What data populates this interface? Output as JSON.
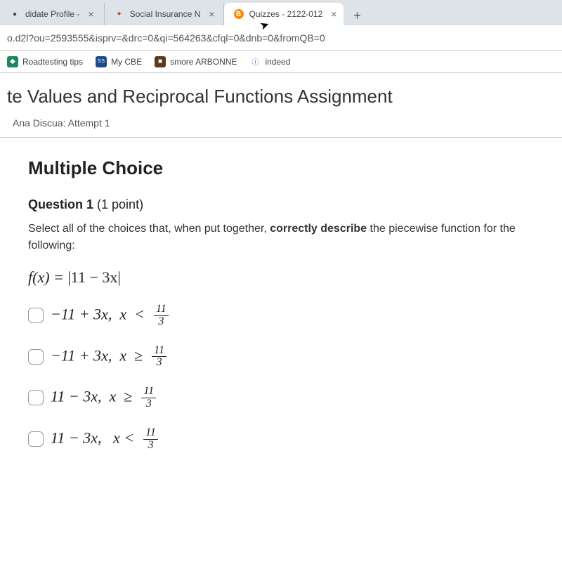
{
  "tabs": [
    {
      "label": "didate Profile -",
      "favicon_color": "#888"
    },
    {
      "label": "Social Insurance N",
      "favicon_color": "#d52b1e"
    },
    {
      "label": "Quizzes - 2122-012",
      "favicon_color": "#ff8a00",
      "active": true
    }
  ],
  "address_url": "o.d2l?ou=2593555&isprv=&drc=0&qi=564263&cfql=0&dnb=0&fromQB=0",
  "bookmarks": [
    {
      "label": "Roadtesting tips",
      "icon_bg": "#1a8a5a"
    },
    {
      "label": "My CBE",
      "icon_bg": "#1a4d8a"
    },
    {
      "label": "smore ARBONNE",
      "icon_bg": "#5a3a1a"
    },
    {
      "label": "indeed",
      "icon_bg": "transparent"
    }
  ],
  "page_title": "te Values and Reciprocal Functions Assignment",
  "attempt": "Ana Discua: Attempt 1",
  "section_heading": "Multiple Choice",
  "question_number": "Question 1",
  "question_points": "(1 point)",
  "question_prompt_a": "Select all of the choices that, when put together, ",
  "question_prompt_bold": "correctly describe",
  "question_prompt_b": " the piecewise function for the following:",
  "equation_lhs": "f(x) = ",
  "equation_rhs": "|11 − 3x|",
  "choices": [
    {
      "expr": "−11 + 3x,  x  <",
      "frac_num": "11",
      "frac_den": "3",
      "op": "<"
    },
    {
      "expr": "−11 + 3x,  x",
      "frac_num": "11",
      "frac_den": "3",
      "op": "≥"
    },
    {
      "expr": "11 − 3x,  x",
      "frac_num": "11",
      "frac_den": "3",
      "op": "≥"
    },
    {
      "expr": "11 − 3x,   x",
      "frac_num": "11",
      "frac_den": "3",
      "op": "<"
    }
  ]
}
